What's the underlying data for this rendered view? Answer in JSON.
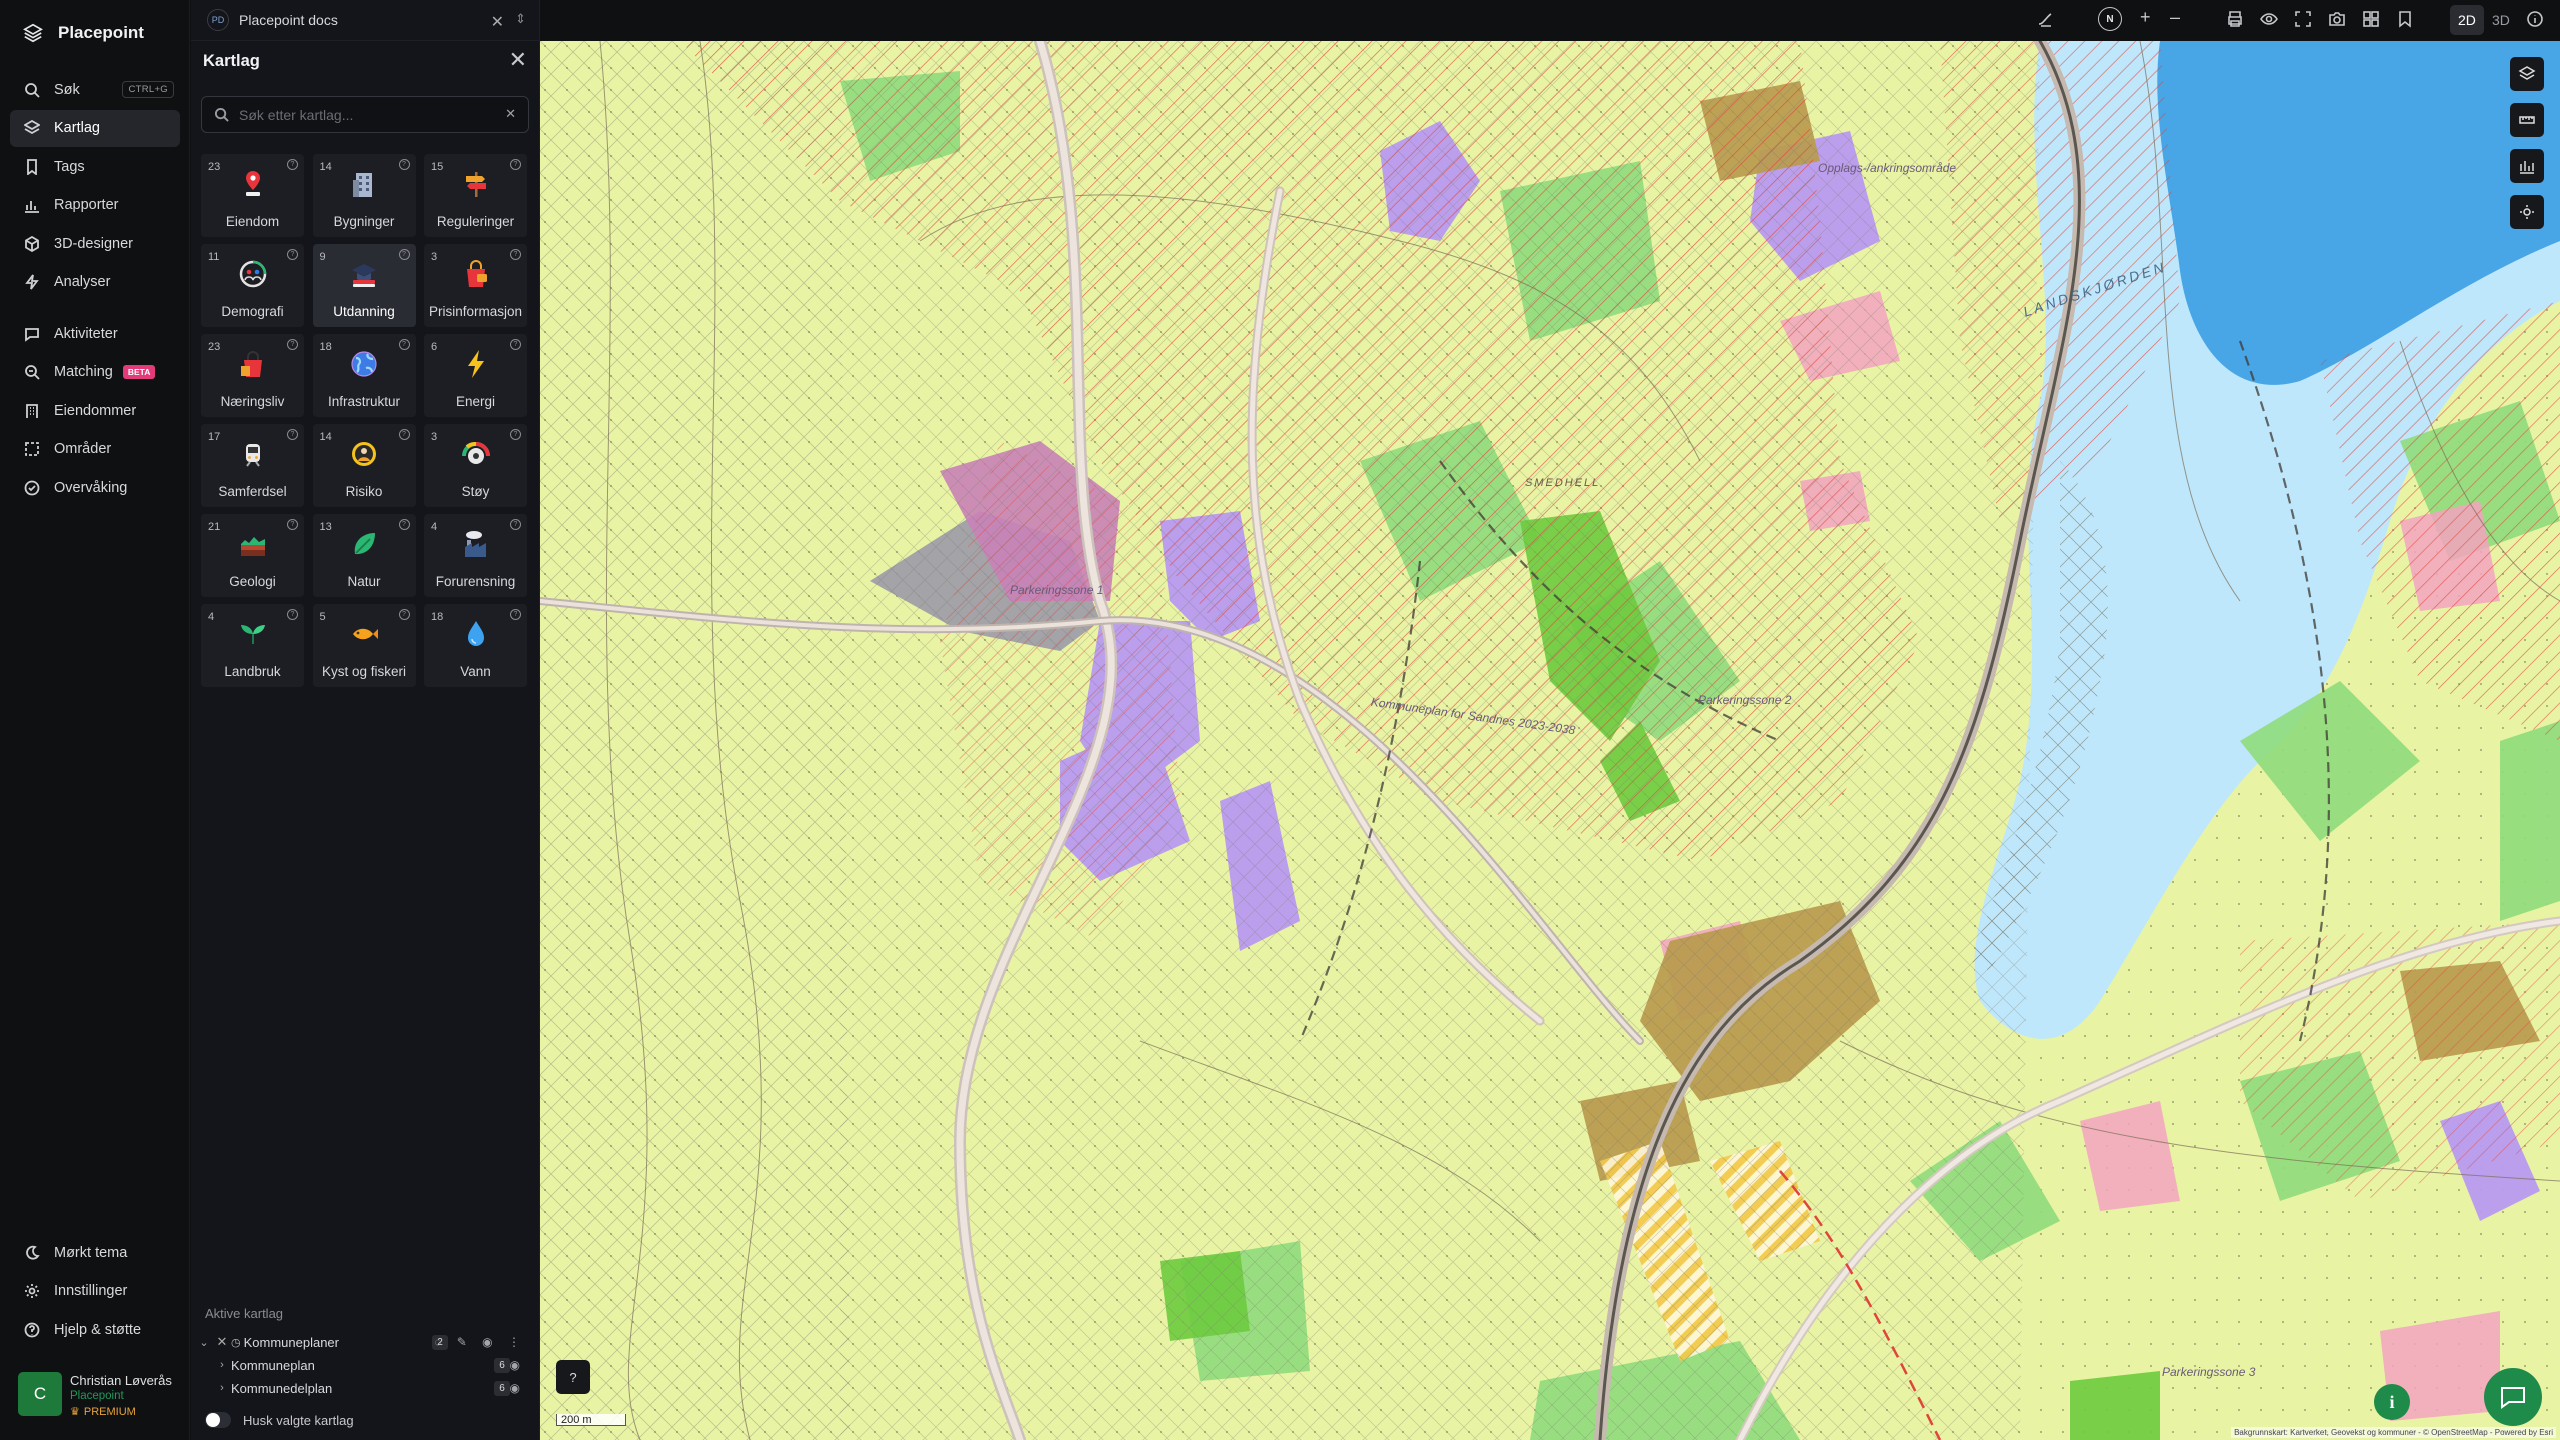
{
  "app": {
    "name": "Placepoint"
  },
  "nav": {
    "items": [
      {
        "label": "Søk",
        "icon": "search-icon",
        "shortcut": "CTRL+G"
      },
      {
        "label": "Kartlag",
        "icon": "layers-icon",
        "active": true
      },
      {
        "label": "Tags",
        "icon": "bookmark-icon"
      },
      {
        "label": "Rapporter",
        "icon": "bar-chart-icon"
      },
      {
        "label": "3D-designer",
        "icon": "cube-icon"
      },
      {
        "label": "Analyser",
        "icon": "bolt-icon"
      },
      {
        "label": "Aktiviteter",
        "icon": "chat-icon"
      },
      {
        "label": "Matching",
        "icon": "match-icon",
        "badge": "BETA"
      },
      {
        "label": "Eiendommer",
        "icon": "building-icon"
      },
      {
        "label": "Områder",
        "icon": "area-icon"
      },
      {
        "label": "Overvåking",
        "icon": "monitor-icon"
      }
    ],
    "bottom": [
      {
        "label": "Mørkt tema",
        "icon": "moon-icon"
      },
      {
        "label": "Innstillinger",
        "icon": "gear-icon"
      },
      {
        "label": "Hjelp & støtte",
        "icon": "help-icon"
      }
    ],
    "user": {
      "initial": "C",
      "name": "Christian Løverås",
      "org": "Placepoint",
      "plan": "PREMIUM"
    }
  },
  "docs": {
    "badge": "PD",
    "title": "Placepoint docs"
  },
  "panel": {
    "title": "Kartlag",
    "search_placeholder": "Søk etter kartlag...",
    "tiles": [
      {
        "count": "23",
        "label": "Eiendom",
        "icon": "pin-icon"
      },
      {
        "count": "14",
        "label": "Bygninger",
        "icon": "building-icon"
      },
      {
        "count": "15",
        "label": "Reguleringer",
        "icon": "signpost-icon"
      },
      {
        "count": "11",
        "label": "Demografi",
        "icon": "demography-icon"
      },
      {
        "count": "9",
        "label": "Utdanning",
        "icon": "graduation-icon",
        "active": true
      },
      {
        "count": "3",
        "label": "Prisinformasjon",
        "icon": "price-bag-icon"
      },
      {
        "count": "23",
        "label": "Næringsliv",
        "icon": "shopping-bag-icon"
      },
      {
        "count": "18",
        "label": "Infrastruktur",
        "icon": "globe-icon"
      },
      {
        "count": "6",
        "label": "Energi",
        "icon": "lightning-icon"
      },
      {
        "count": "17",
        "label": "Samferdsel",
        "icon": "train-icon"
      },
      {
        "count": "14",
        "label": "Risiko",
        "icon": "hazard-icon"
      },
      {
        "count": "3",
        "label": "Støy",
        "icon": "noise-gauge-icon"
      },
      {
        "count": "21",
        "label": "Geologi",
        "icon": "geology-icon"
      },
      {
        "count": "13",
        "label": "Natur",
        "icon": "leaf-icon"
      },
      {
        "count": "4",
        "label": "Forurensning",
        "icon": "factory-icon"
      },
      {
        "count": "4",
        "label": "Landbruk",
        "icon": "sprout-icon"
      },
      {
        "count": "5",
        "label": "Kyst og fiskeri",
        "icon": "fish-icon"
      },
      {
        "count": "18",
        "label": "Vann",
        "icon": "water-drop-icon"
      }
    ],
    "active_title": "Aktive kartlag",
    "active_layers": [
      {
        "label": "Kommuneplaner",
        "count": "2"
      },
      {
        "label": "Kommuneplan",
        "count": "6"
      },
      {
        "label": "Kommunedelplan",
        "count": "6"
      }
    ],
    "hide_selected": "Husk valgte kartlag"
  },
  "topbar": {
    "north": "N",
    "dim2d": "2D",
    "dim3d": "3D",
    "active_mode": "2D"
  },
  "map": {
    "labels": [
      "Opplags-/ankringsområde",
      "LANDSKJØRDEN",
      "Parkeringssone 1",
      "Kommuneplan for Sandnes 2023-2038",
      "Parkeringssone 2",
      "Parkeringssone 3",
      "SMEDHELL"
    ],
    "scale": "200 m",
    "attribution": "Bakgrunnskart: Kartverket, Geovekst og kommuner - © OpenStreetMap - Powered by Esri"
  },
  "colors": {
    "accent_green": "#1f8b4b",
    "beta_pink": "#e33a79",
    "premium_orange": "#e8a33a",
    "map_yellow": "#e8f3a4",
    "map_purple": "#b99af0",
    "map_water": "#9ed6f5"
  }
}
